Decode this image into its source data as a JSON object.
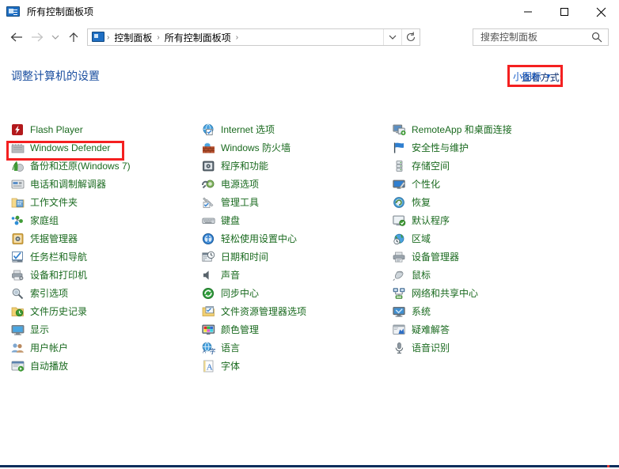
{
  "window": {
    "title": "所有控制面板项",
    "title_icon": "control-panel-icon",
    "minimize_label": "minimize",
    "maximize_label": "maximize",
    "close_label": "close"
  },
  "nav": {
    "back_label": "←",
    "forward_label": "→",
    "recent_label": "⌄",
    "up_label": "↑",
    "breadcrumbs": [
      {
        "label": "控制面板"
      },
      {
        "label": "所有控制面板项"
      }
    ],
    "separator": "›",
    "dropdown_label": "⌄",
    "refresh_label": "↻"
  },
  "search": {
    "placeholder": "搜索控制面板",
    "value": "",
    "icon": "search-icon"
  },
  "header": {
    "page_title": "调整计算机的设置",
    "view_by_label": "查看方式:",
    "view_by_value": "小图标",
    "caret": "▼"
  },
  "highlight_color": "#f42020",
  "accent": {
    "title_blue": "#1b4fa0",
    "link_green": "#1a6a1f",
    "view_blue": "#1a5fc8"
  },
  "columns": [
    {
      "items": [
        {
          "label": "Flash Player",
          "icon": "flash-player-icon"
        },
        {
          "label": "Windows Defender",
          "icon": "windows-defender-icon",
          "highlighted": true
        },
        {
          "label": "备份和还原(Windows 7)",
          "icon": "backup-restore-icon"
        },
        {
          "label": "电话和调制解调器",
          "icon": "phone-modem-icon"
        },
        {
          "label": "工作文件夹",
          "icon": "work-folders-icon"
        },
        {
          "label": "家庭组",
          "icon": "homegroup-icon"
        },
        {
          "label": "凭据管理器",
          "icon": "credential-manager-icon"
        },
        {
          "label": "任务栏和导航",
          "icon": "taskbar-navigation-icon"
        },
        {
          "label": "设备和打印机",
          "icon": "devices-printers-icon"
        },
        {
          "label": "索引选项",
          "icon": "indexing-options-icon"
        },
        {
          "label": "文件历史记录",
          "icon": "file-history-icon"
        },
        {
          "label": "显示",
          "icon": "display-icon"
        },
        {
          "label": "用户帐户",
          "icon": "user-accounts-icon"
        },
        {
          "label": "自动播放",
          "icon": "autoplay-icon"
        }
      ]
    },
    {
      "items": [
        {
          "label": "Internet 选项",
          "icon": "internet-options-icon"
        },
        {
          "label": "Windows 防火墙",
          "icon": "windows-firewall-icon"
        },
        {
          "label": "程序和功能",
          "icon": "programs-features-icon"
        },
        {
          "label": "电源选项",
          "icon": "power-options-icon"
        },
        {
          "label": "管理工具",
          "icon": "administrative-tools-icon"
        },
        {
          "label": "键盘",
          "icon": "keyboard-icon"
        },
        {
          "label": "轻松使用设置中心",
          "icon": "ease-of-access-icon"
        },
        {
          "label": "日期和时间",
          "icon": "date-time-icon"
        },
        {
          "label": "声音",
          "icon": "sound-icon"
        },
        {
          "label": "同步中心",
          "icon": "sync-center-icon"
        },
        {
          "label": "文件资源管理器选项",
          "icon": "file-explorer-options-icon"
        },
        {
          "label": "颜色管理",
          "icon": "color-management-icon"
        },
        {
          "label": "语言",
          "icon": "language-icon"
        },
        {
          "label": "字体",
          "icon": "fonts-icon"
        }
      ]
    },
    {
      "items": [
        {
          "label": "RemoteApp 和桌面连接",
          "icon": "remoteapp-desktop-icon"
        },
        {
          "label": "安全性与维护",
          "icon": "security-maintenance-icon"
        },
        {
          "label": "存储空间",
          "icon": "storage-spaces-icon"
        },
        {
          "label": "个性化",
          "icon": "personalization-icon"
        },
        {
          "label": "恢复",
          "icon": "recovery-icon"
        },
        {
          "label": "默认程序",
          "icon": "default-programs-icon"
        },
        {
          "label": "区域",
          "icon": "region-icon"
        },
        {
          "label": "设备管理器",
          "icon": "device-manager-icon"
        },
        {
          "label": "鼠标",
          "icon": "mouse-icon"
        },
        {
          "label": "网络和共享中心",
          "icon": "network-sharing-icon"
        },
        {
          "label": "系统",
          "icon": "system-icon"
        },
        {
          "label": "疑难解答",
          "icon": "troubleshooting-icon"
        },
        {
          "label": "语音识别",
          "icon": "speech-recognition-icon"
        }
      ]
    }
  ]
}
